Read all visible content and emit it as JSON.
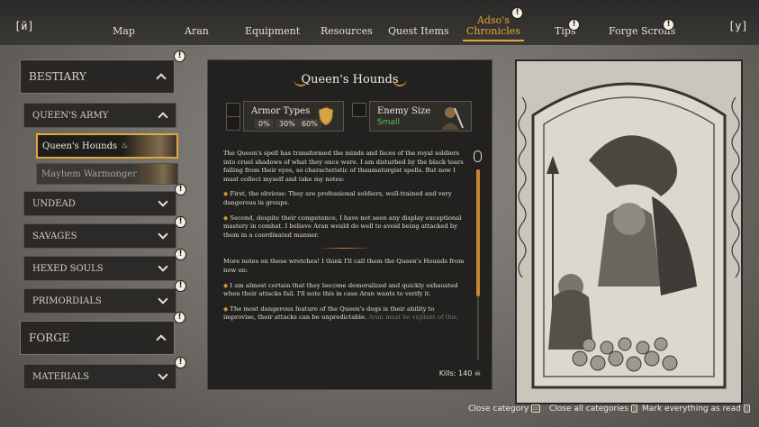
{
  "nav": {
    "prev_key": "[й]",
    "next_key": "[у]",
    "tabs": [
      {
        "label": "Map"
      },
      {
        "label": "Aran"
      },
      {
        "label": "Equipment"
      },
      {
        "label": "Resources"
      },
      {
        "label": "Quest Items"
      },
      {
        "label_line1": "Adso's",
        "label_line2": "Chronicles",
        "active": true
      },
      {
        "label": "Tips"
      },
      {
        "label": "Forge Scrolls"
      }
    ],
    "badge": "!"
  },
  "sidebar": {
    "bestiary": "BESTIARY",
    "queens_army": "QUEEN'S ARMY",
    "entries": [
      {
        "label": "Queen's Hounds",
        "selected": true
      },
      {
        "label": "Mayhem Warmonger",
        "selected": false
      }
    ],
    "categories": [
      "UNDEAD",
      "SAVAGES",
      "HEXED SOULS",
      "PRIMORDIALS"
    ],
    "forge": "FORGE",
    "materials": "MATERIALS"
  },
  "entry": {
    "title": "Queen's Hounds",
    "armor_types_label": "Armor Types",
    "armor_values": [
      "0%",
      "30%",
      "60%"
    ],
    "enemy_size_label": "Enemy Size",
    "enemy_size_value": "Small",
    "paragraphs": [
      "The Queen's spell has transformed the minds and faces of the royal soldiers into cruel shadows of what they once were. I am disturbed by the black tears falling from their eyes, so characteristic of thaumaturgist spells. But now I must collect myself and take my notes:",
      "First, the obvious: They are professional soldiers, well-trained and very dangerous in groups.",
      "Second, despite their competence, I have not seen any display exceptional mastery in combat. I believe Aran would do well to avoid being attacked by them in a coordinated manner.",
      "More notes on these wretches! I think I'll call them the Queen's Hounds from now on:",
      "I am almost certain that they become demoralized and quickly exhausted when their attacks fail. I'll note this in case Aran wants to verify it.",
      "The most dangerous feature of the Queen's dogs is their ability to improvise, their attacks can be unpredictable."
    ],
    "faded_tail": "Aran must be vigilant of this.",
    "bullet": "◆",
    "kills_label": "Kills: 140"
  },
  "footer": {
    "close_category": "Close category",
    "close_all": "Close all categories",
    "mark_all": "Mark everything as read"
  },
  "colors": {
    "accent": "#e2a739",
    "small_size": "#57c24f"
  }
}
